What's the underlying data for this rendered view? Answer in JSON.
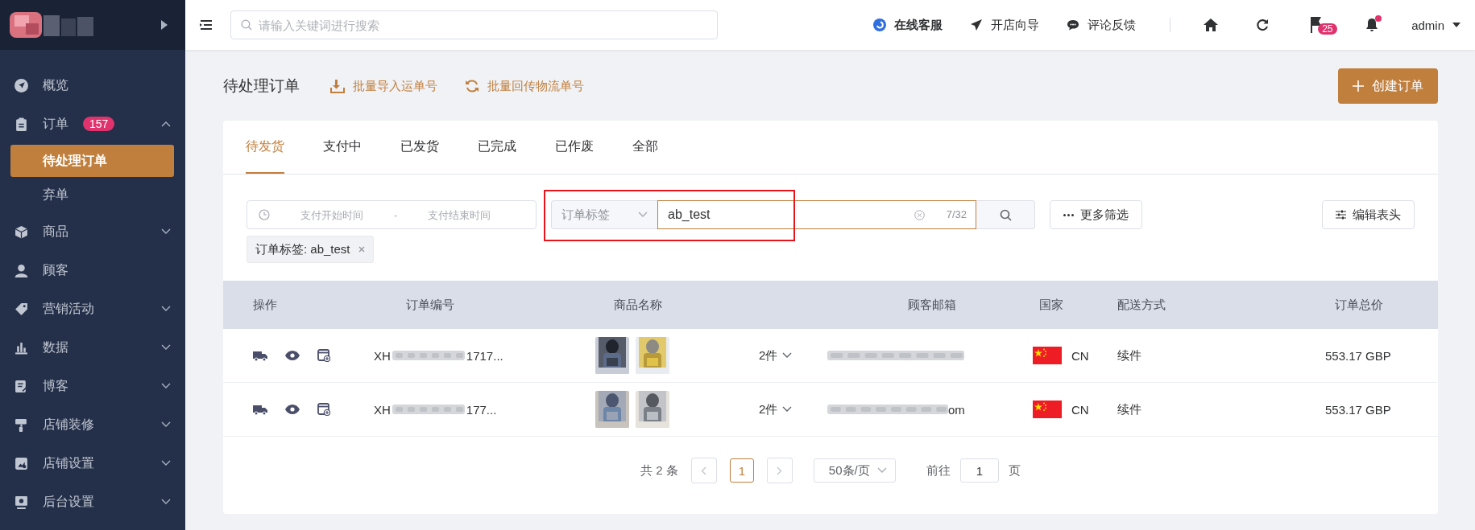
{
  "sidebar": {
    "items": [
      {
        "label": "概览",
        "kind": "link"
      },
      {
        "label": "订单",
        "kind": "group",
        "expanded": true,
        "badge": "157",
        "children": [
          {
            "label": "待处理订单",
            "selected": true
          },
          {
            "label": "弃单",
            "selected": false
          }
        ]
      },
      {
        "label": "商品",
        "kind": "group",
        "expanded": false
      },
      {
        "label": "顾客",
        "kind": "link"
      },
      {
        "label": "营销活动",
        "kind": "group",
        "expanded": false
      },
      {
        "label": "数据",
        "kind": "group",
        "expanded": false
      },
      {
        "label": "博客",
        "kind": "group",
        "expanded": false
      },
      {
        "label": "店铺装修",
        "kind": "group",
        "expanded": false
      },
      {
        "label": "店铺设置",
        "kind": "group",
        "expanded": false
      },
      {
        "label": "后台设置",
        "kind": "group",
        "expanded": false
      }
    ]
  },
  "topbar": {
    "search": {
      "placeholder": "请输入关键词进行搜索"
    },
    "links": [
      {
        "label": "在线客服",
        "emphasized": true
      },
      {
        "label": "开店向导",
        "emphasized": false
      },
      {
        "label": "评论反馈",
        "emphasized": false
      }
    ],
    "flag_badge": "25",
    "bell_alert": true,
    "user": "admin"
  },
  "page": {
    "title": "待处理订单",
    "actions": [
      "批量导入运单号",
      "批量回传物流单号"
    ],
    "create_button": "创建订单"
  },
  "tabs": [
    {
      "label": "待发货",
      "selected": true
    },
    {
      "label": "支付中",
      "selected": false
    },
    {
      "label": "已发货",
      "selected": false
    },
    {
      "label": "已完成",
      "selected": false
    },
    {
      "label": "已作废",
      "selected": false
    },
    {
      "label": "全部",
      "selected": false
    }
  ],
  "filters": {
    "date_range": {
      "start_placeholder": "支付开始时间",
      "separator": "-",
      "end_placeholder": "支付结束时间"
    },
    "tag_filter": {
      "select": "订单标签",
      "value": "ab_test",
      "count": "7/32",
      "annotated": true
    },
    "more_filters": "更多筛选",
    "edit_columns": "编辑表头",
    "chips": [
      {
        "label": "订单标签: ab_test"
      }
    ]
  },
  "table": {
    "columns": [
      "操作",
      "订单编号",
      "商品名称",
      "",
      "顾客邮箱",
      "国家",
      "配送方式",
      "订单总价"
    ],
    "rows": [
      {
        "order_prefix": "XH",
        "order_suffix": "1717...",
        "quantity": "2件",
        "email_suffix": "",
        "country": "CN",
        "shipping": "续件",
        "total": "553.17 GBP"
      },
      {
        "order_prefix": "XH",
        "order_suffix": "177...",
        "quantity": "2件",
        "email_suffix": "om",
        "country": "CN",
        "shipping": "续件",
        "total": "553.17 GBP"
      }
    ]
  },
  "pagination": {
    "total": "共 2 条",
    "pages": [
      {
        "label": "1",
        "selected": true
      }
    ],
    "page_size": "50条/页",
    "goto_label": "前往",
    "goto_value": "1",
    "goto_unit": "页"
  }
}
